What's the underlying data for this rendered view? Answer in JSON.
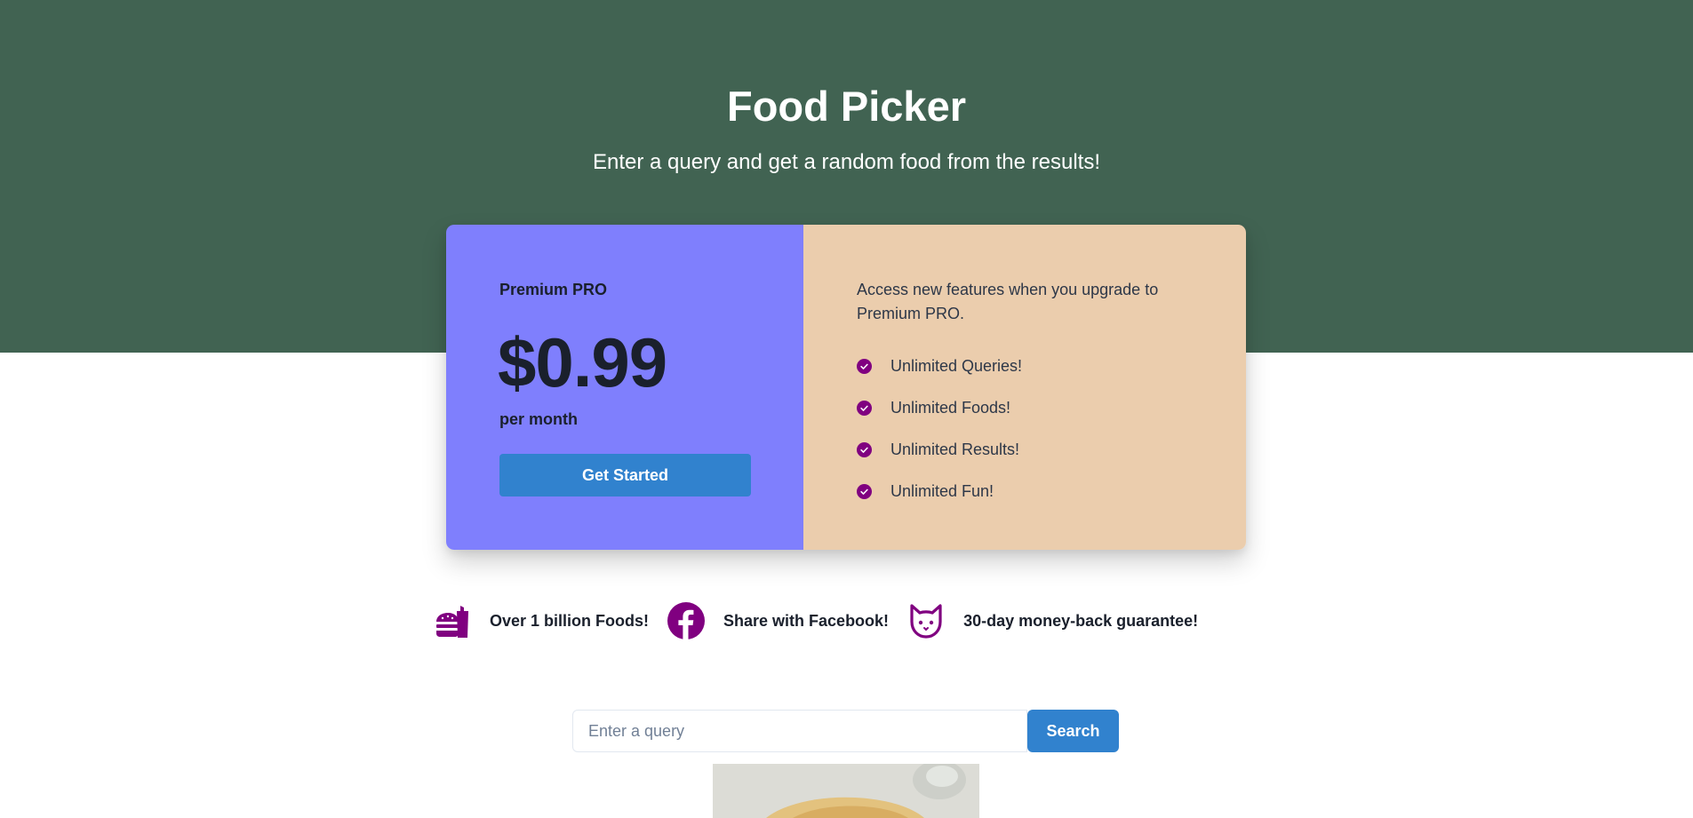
{
  "hero": {
    "title": "Food Picker",
    "subtitle": "Enter a query and get a random food from the results!",
    "background_color": "#416352"
  },
  "pricing": {
    "plan_name": "Premium PRO",
    "price": "$0.99",
    "period": "per month",
    "cta_label": "Get Started",
    "left_color": "#7f7ffd",
    "right_color": "#ebcdad",
    "features_intro": "Access new features when you upgrade to Premium PRO.",
    "features": [
      {
        "label": "Unlimited Queries!",
        "icon": "check-circle-icon"
      },
      {
        "label": "Unlimited Foods!",
        "icon": "check-circle-icon"
      },
      {
        "label": "Unlimited Results!",
        "icon": "check-circle-icon"
      },
      {
        "label": "Unlimited Fun!",
        "icon": "check-circle-icon"
      }
    ]
  },
  "highlights": [
    {
      "icon": "hamburger-icon",
      "label": "Over 1 billion Foods!"
    },
    {
      "icon": "facebook-icon",
      "label": "Share with Facebook!"
    },
    {
      "icon": "cat-icon",
      "label": "30-day money-back guarantee!"
    }
  ],
  "search": {
    "placeholder": "Enter a query",
    "value": "",
    "button_label": "Search"
  },
  "colors": {
    "accent": "#3182ce",
    "icon_purple": "#800080"
  }
}
